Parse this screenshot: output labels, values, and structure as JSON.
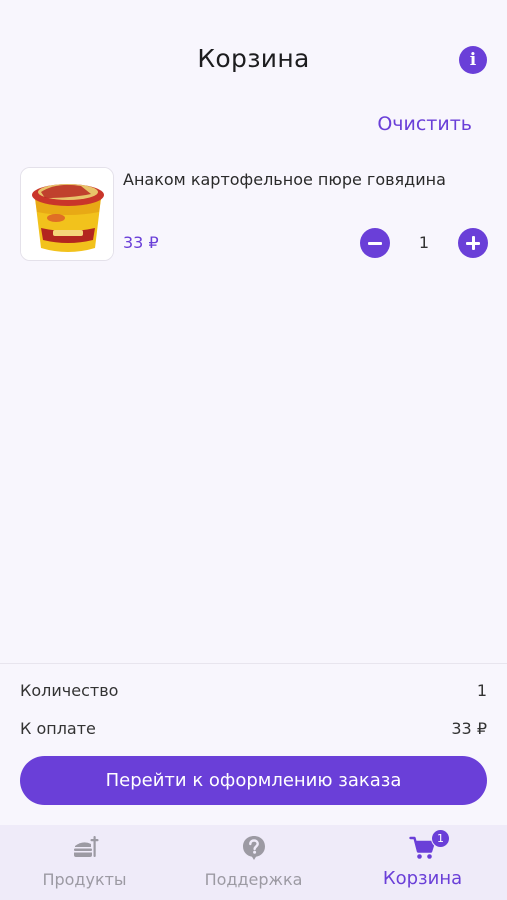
{
  "header": {
    "title": "Корзина",
    "info_icon": "info-icon",
    "clear_label": "Очистить"
  },
  "cart": {
    "items": [
      {
        "name": "Анаком картофельное пюре говядина",
        "price": "33 ₽",
        "quantity": "1",
        "image_icon": "product-image"
      }
    ]
  },
  "summary": {
    "quantity_label": "Количество",
    "quantity_value": "1",
    "total_label": "К оплате",
    "total_value": "33 ₽",
    "checkout_label": "Перейти к оформлению заказа"
  },
  "tabbar": {
    "tabs": [
      {
        "label": "Продукты",
        "icon": "products-icon",
        "active": false
      },
      {
        "label": "Поддержка",
        "icon": "support-icon",
        "active": false
      },
      {
        "label": "Корзина",
        "icon": "cart-icon",
        "active": true,
        "badge": "1"
      }
    ]
  },
  "colors": {
    "accent": "#6a3fd8",
    "background": "#f8f6fd",
    "tabbar_bg": "#efebf9",
    "inactive": "#9c9aa3"
  }
}
